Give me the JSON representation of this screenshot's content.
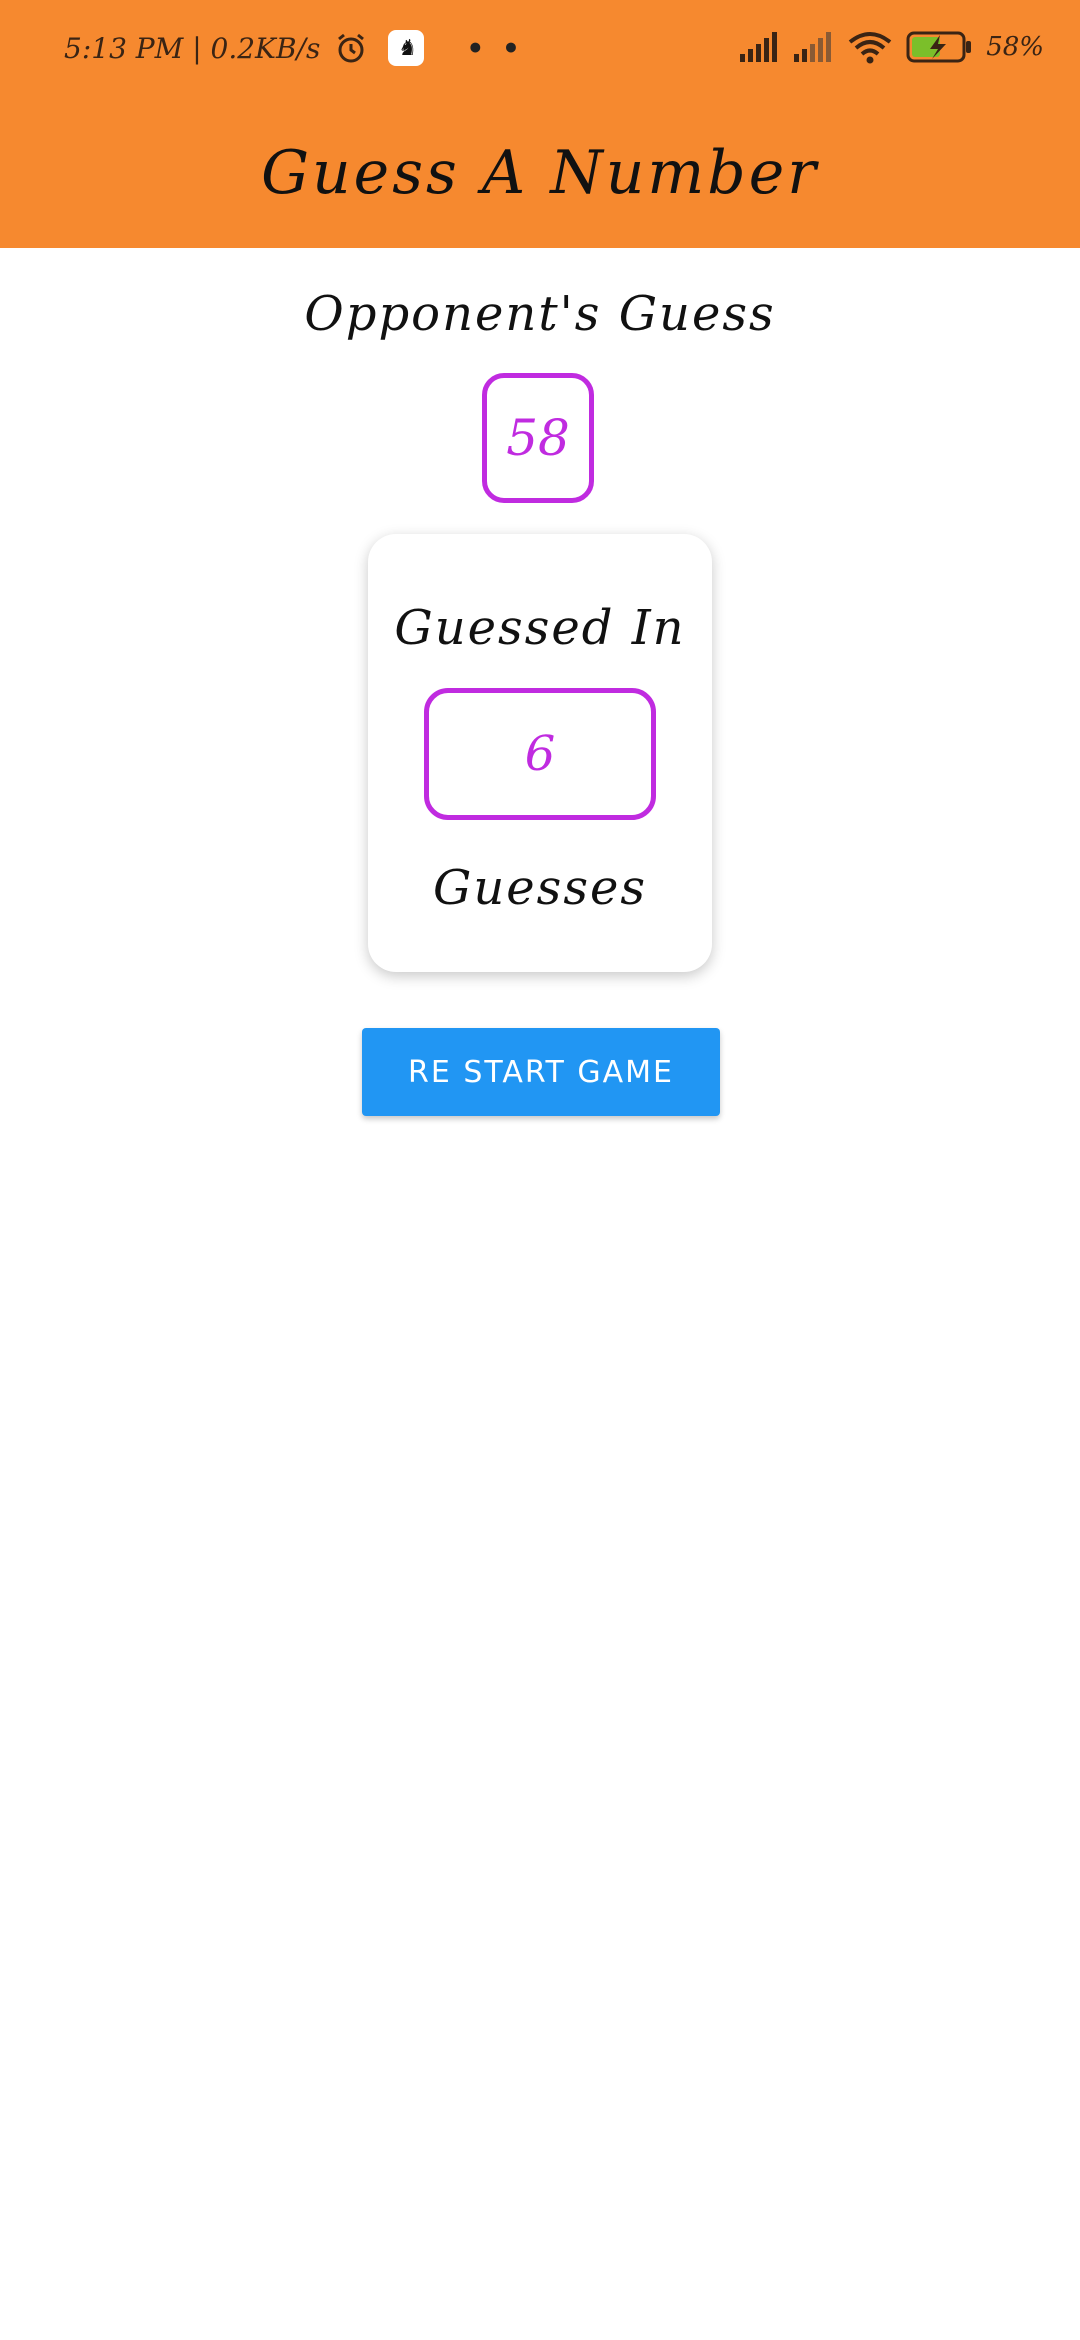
{
  "colors": {
    "header_bg": "#F6892F",
    "accent_purple": "#C02BE0",
    "button_blue": "#2196F3"
  },
  "status_bar": {
    "time_speed": "5:13 PM | 0.2KB/s",
    "battery_percent": "58%",
    "icons": [
      "alarm-icon",
      "app-notification-icon",
      "more-dots-icon",
      "signal-icon",
      "signal-icon-2",
      "wifi-icon",
      "battery-charging-icon"
    ]
  },
  "header": {
    "title": "Guess A Number"
  },
  "main": {
    "opponent_label": "Opponent's Guess",
    "opponent_guess": "58",
    "card": {
      "guessed_in_label": "Guessed In",
      "guess_count": "6",
      "guesses_label": "Guesses"
    },
    "restart_button_label": "RE START GAME"
  }
}
